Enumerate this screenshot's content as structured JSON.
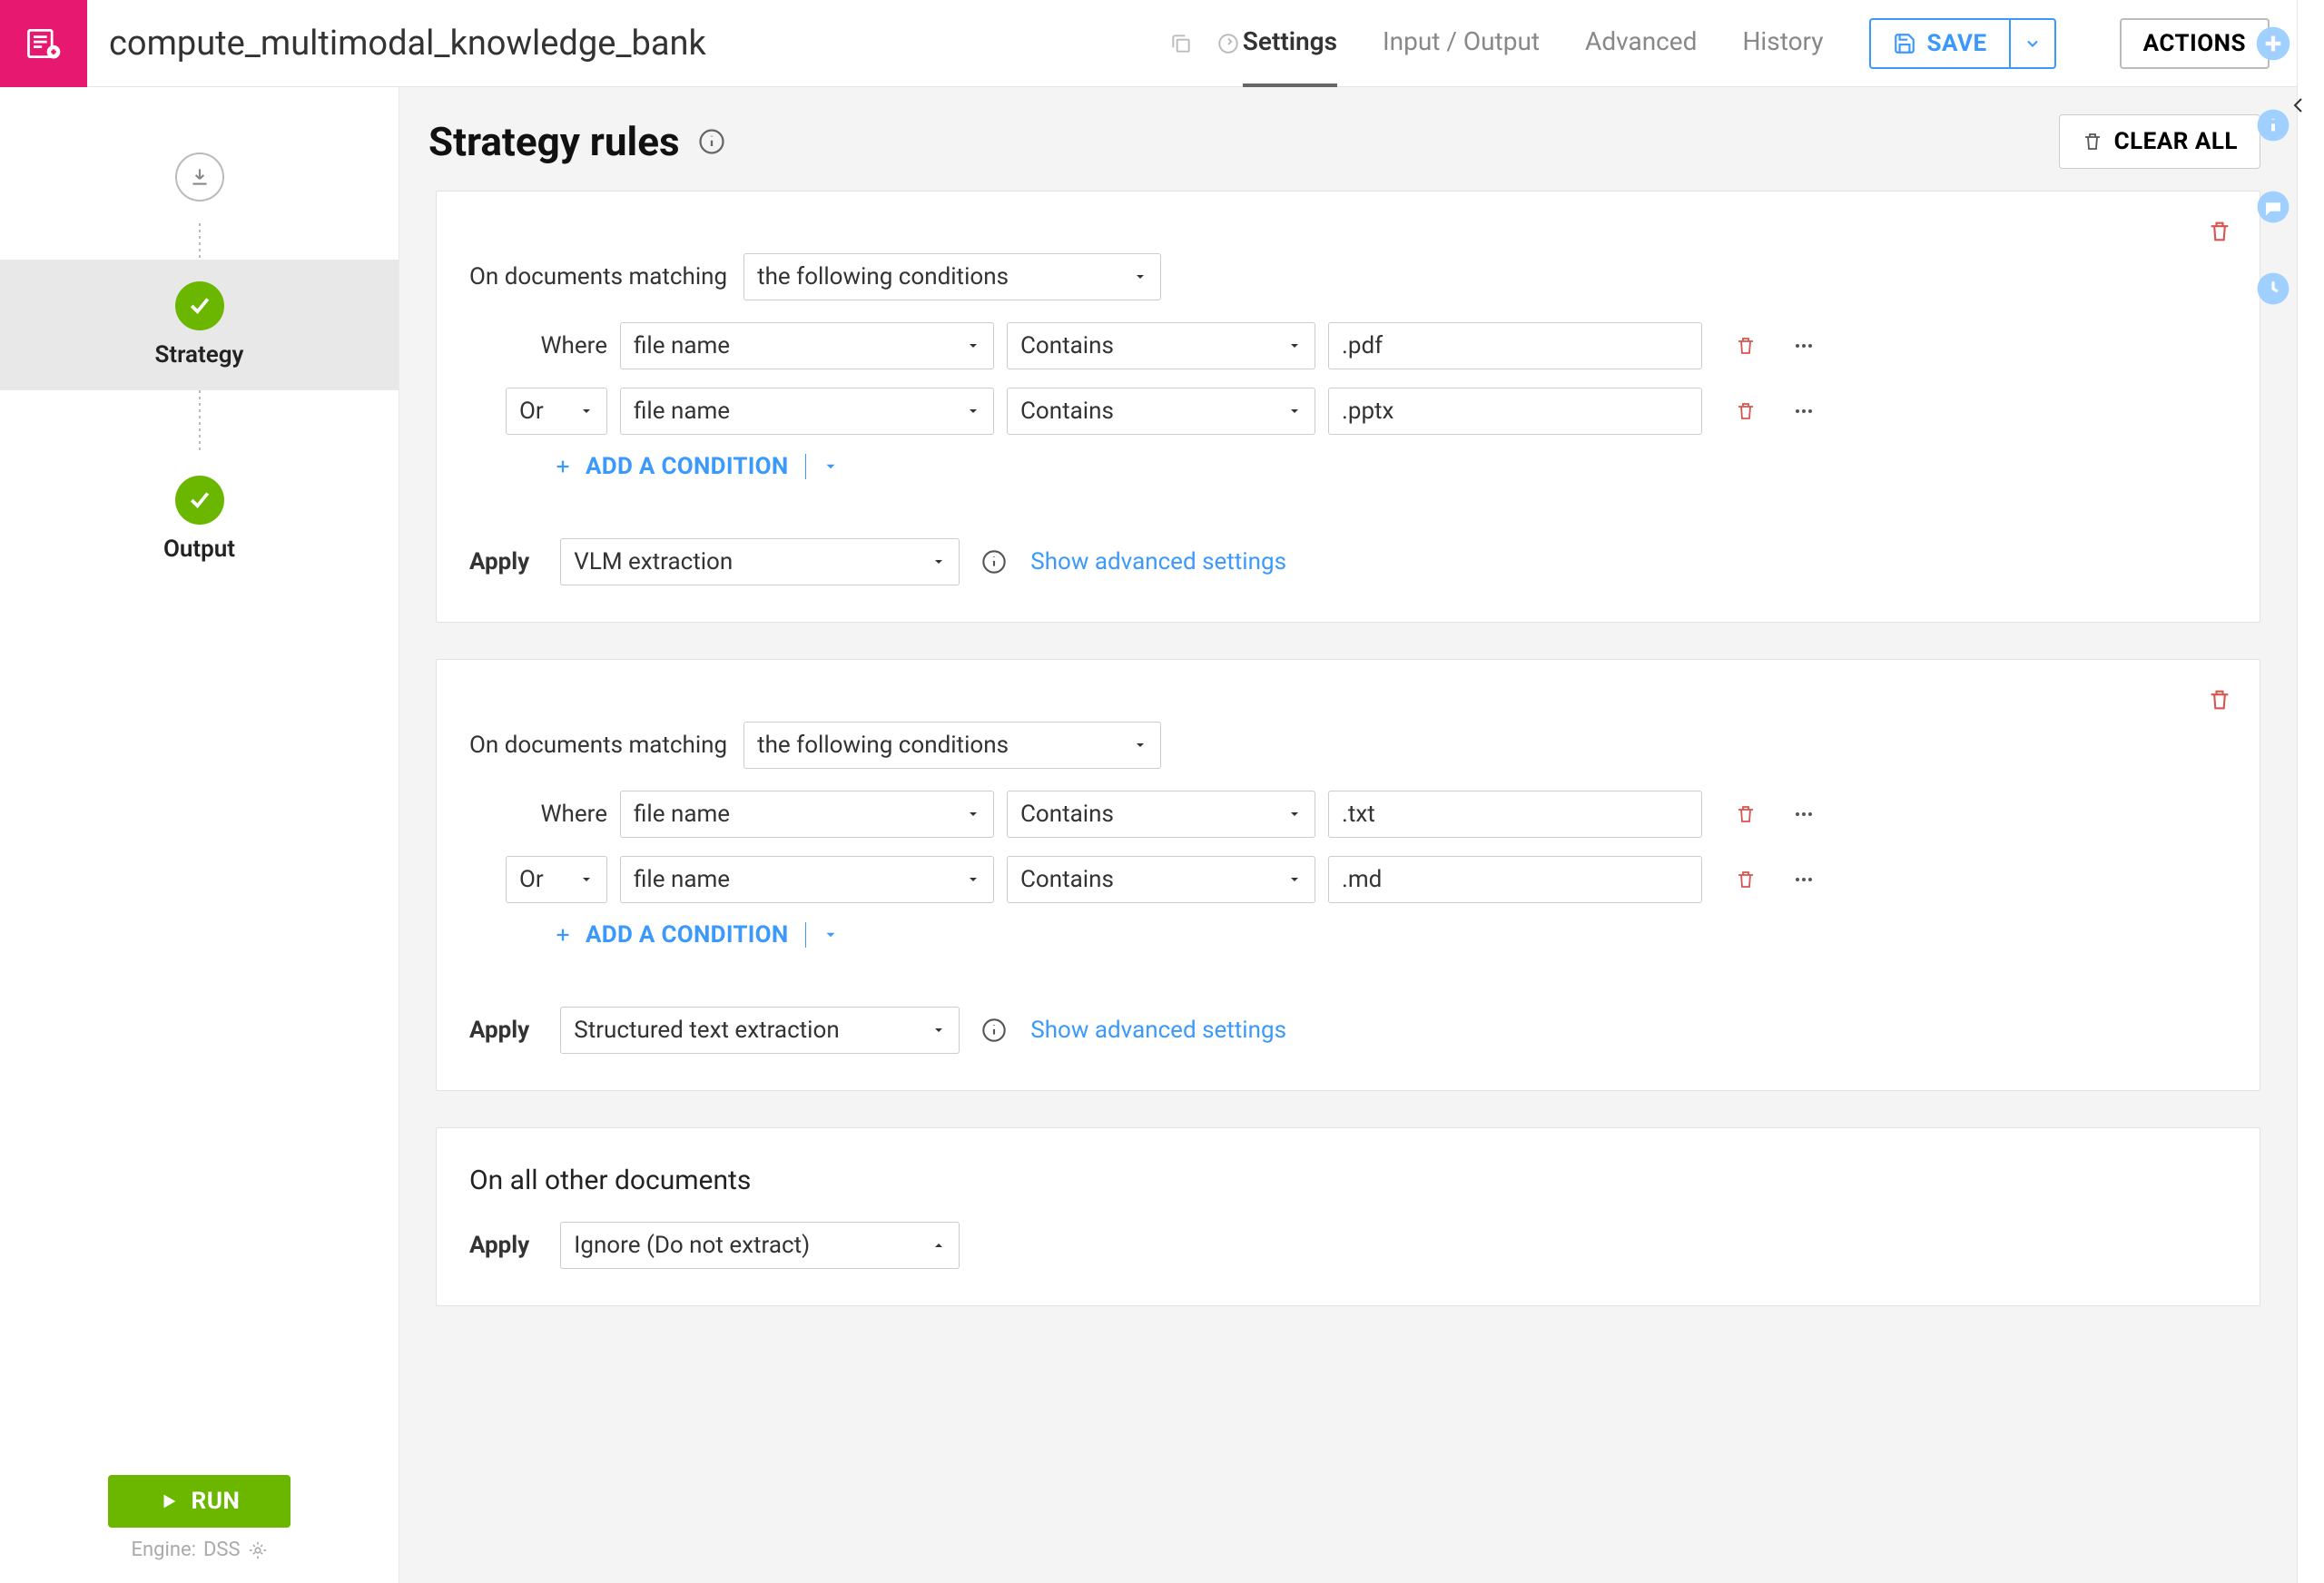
{
  "header": {
    "title": "compute_multimodal_knowledge_bank",
    "nav": [
      "Settings",
      "Input / Output",
      "Advanced",
      "History"
    ],
    "active_nav": "Settings",
    "save": "SAVE",
    "actions": "ACTIONS"
  },
  "left": {
    "input_node": "",
    "strategy_node": "Strategy",
    "output_node": "Output",
    "run": "RUN",
    "engine_prefix": "Engine:",
    "engine_value": "DSS"
  },
  "page": {
    "title": "Strategy rules",
    "clear": "CLEAR ALL"
  },
  "rules": [
    {
      "match_label": "On documents matching",
      "match_mode": "the following conditions",
      "where_label": "Where",
      "conditions": [
        {
          "join": "",
          "field": "file name",
          "op": "Contains",
          "value": ".pdf"
        },
        {
          "join": "Or",
          "field": "file name",
          "op": "Contains",
          "value": ".pptx"
        }
      ],
      "add_cond": "ADD A CONDITION",
      "apply_label": "Apply",
      "apply_value": "VLM extraction",
      "adv": "Show advanced settings"
    },
    {
      "match_label": "On documents matching",
      "match_mode": "the following conditions",
      "where_label": "Where",
      "conditions": [
        {
          "join": "",
          "field": "file name",
          "op": "Contains",
          "value": ".txt"
        },
        {
          "join": "Or",
          "field": "file name",
          "op": "Contains",
          "value": ".md"
        }
      ],
      "add_cond": "ADD A CONDITION",
      "apply_label": "Apply",
      "apply_value": "Structured text extraction",
      "adv": "Show advanced settings"
    }
  ],
  "fallback": {
    "title": "On all other documents",
    "apply_label": "Apply",
    "apply_value": "Ignore (Do not extract)"
  }
}
